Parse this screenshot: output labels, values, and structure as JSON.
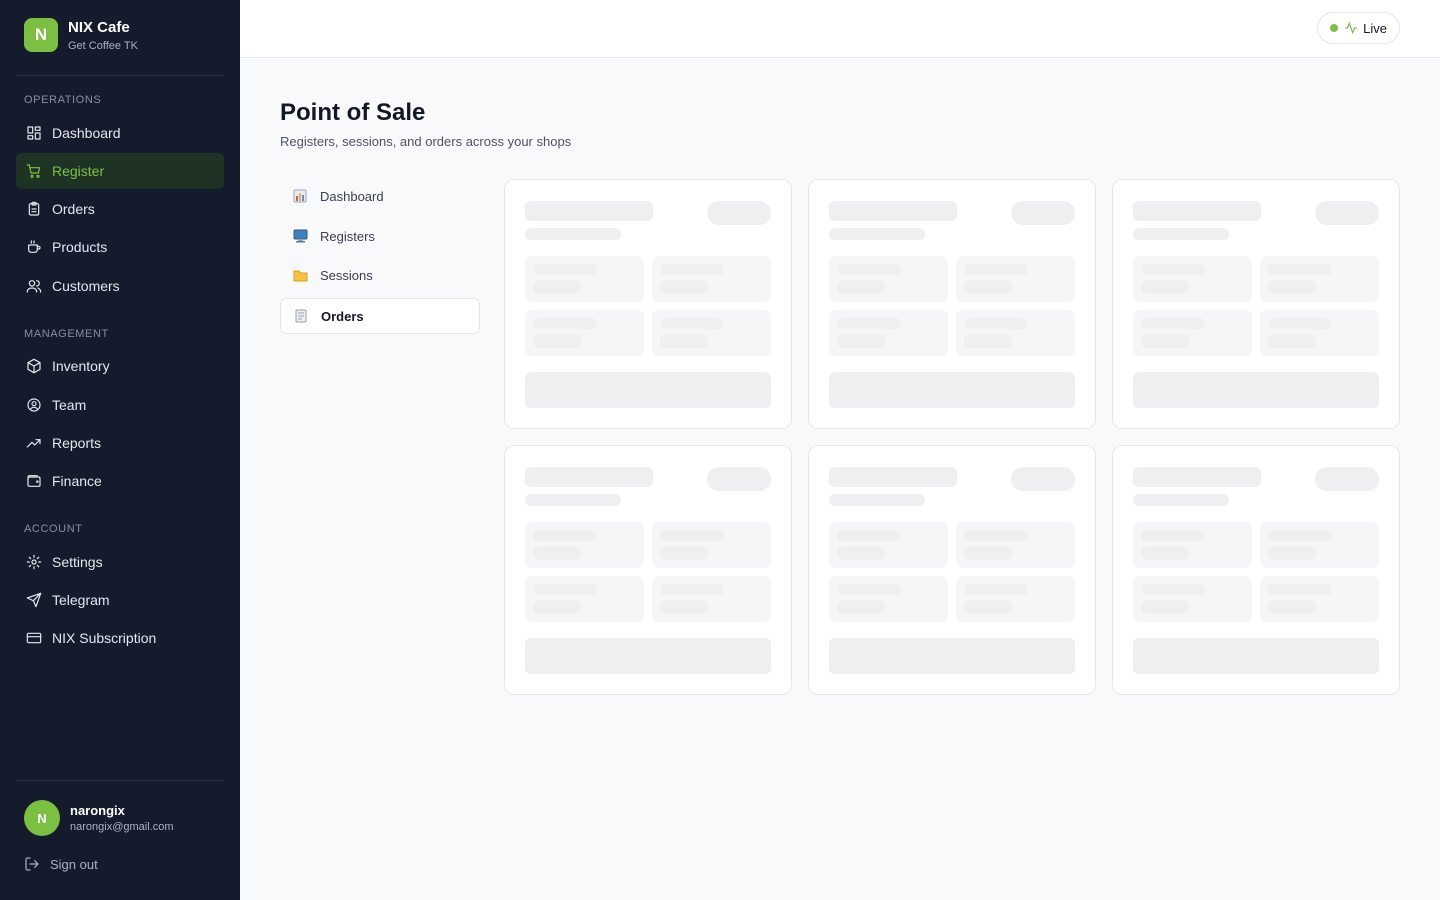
{
  "brand": {
    "initial": "N",
    "name": "NIX Cafe",
    "subtitle": "Get Coffee TK"
  },
  "sidebar": {
    "sections": [
      {
        "label": "OPERATIONS"
      },
      {
        "label": "MANAGEMENT"
      },
      {
        "label": "ACCOUNT"
      }
    ],
    "items": [
      {
        "label": "Dashboard",
        "icon": "dashboard-grid-icon"
      },
      {
        "label": "Register",
        "icon": "cart-icon",
        "active": true
      },
      {
        "label": "Orders",
        "icon": "clipboard-icon"
      },
      {
        "label": "Products",
        "icon": "coffee-cup-icon"
      },
      {
        "label": "Customers",
        "icon": "users-icon"
      },
      {
        "label": "Inventory",
        "icon": "box-icon"
      },
      {
        "label": "Team",
        "icon": "user-circle-icon"
      },
      {
        "label": "Reports",
        "icon": "trending-up-icon"
      },
      {
        "label": "Finance",
        "icon": "wallet-icon"
      },
      {
        "label": "Settings",
        "icon": "gear-icon"
      },
      {
        "label": "Telegram",
        "icon": "send-icon"
      },
      {
        "label": "NIX Subscription",
        "icon": "credit-card-icon"
      }
    ]
  },
  "user": {
    "initial": "N",
    "name": "narongix",
    "email": "narongix@gmail.com",
    "signout_label": "Sign out"
  },
  "topbar": {
    "status_label": "Live"
  },
  "page": {
    "title": "Point of Sale",
    "subtitle": "Registers, sessions, and orders across your shops"
  },
  "subnav": {
    "items": [
      {
        "label": "Dashboard",
        "icon": "bar-chart-icon"
      },
      {
        "label": "Registers",
        "icon": "monitor-icon"
      },
      {
        "label": "Sessions",
        "icon": "folder-icon"
      },
      {
        "label": "Orders",
        "icon": "receipt-icon",
        "active": true
      }
    ]
  },
  "colors": {
    "accent": "#7cc042",
    "sidebar_bg": "#141b2d",
    "active_bg": "#1f3324"
  }
}
